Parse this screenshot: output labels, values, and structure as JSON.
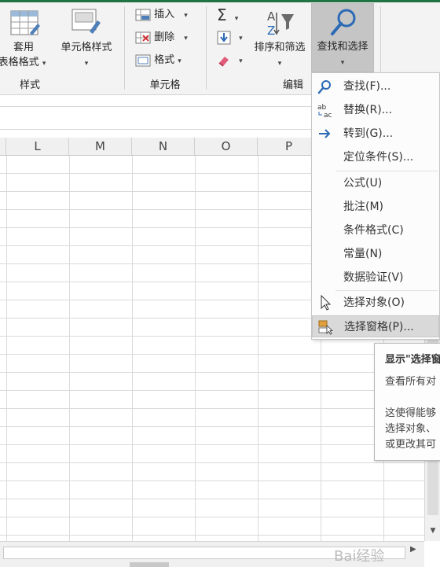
{
  "ribbon": {
    "styles_group": {
      "format_table_label_line1": "套用",
      "format_table_label_line2": "表格格式",
      "cell_styles_label": "单元格样式",
      "group_label": "样式"
    },
    "cells_group": {
      "insert_label": "插入",
      "delete_label": "删除",
      "format_label": "格式",
      "group_label": "单元格"
    },
    "editing_group": {
      "autosum_icon": "sigma-icon",
      "sort_filter_label": "排序和筛选",
      "find_select_label": "查找和选择",
      "group_label": "编辑"
    }
  },
  "columns": [
    "L",
    "M",
    "N",
    "O",
    "P"
  ],
  "menu": {
    "items": [
      {
        "label": "查找(F)...",
        "icon": "search-icon"
      },
      {
        "label": "替换(R)...",
        "icon": "replace-icon"
      },
      {
        "label": "转到(G)...",
        "icon": "arrow-right-icon"
      },
      {
        "label": "定位条件(S)...",
        "icon": ""
      },
      {
        "label": "公式(U)",
        "icon": ""
      },
      {
        "label": "批注(M)",
        "icon": ""
      },
      {
        "label": "条件格式(C)",
        "icon": ""
      },
      {
        "label": "常量(N)",
        "icon": ""
      },
      {
        "label": "数据验证(V)",
        "icon": ""
      },
      {
        "label": "选择对象(O)",
        "icon": "pointer-icon"
      },
      {
        "label": "选择窗格(P)...",
        "icon": "selection-pane-icon"
      }
    ],
    "hovered_index": 10
  },
  "tooltip": {
    "title": "显示\"选择窗",
    "line1": "查看所有对",
    "line2": "这使得能够",
    "line3": "选择对象、",
    "line4": "或更改其可"
  },
  "watermark": "Bai经验",
  "colors": {
    "accent_green": "#217346",
    "ribbon_bg": "#f3f3f3",
    "selected_button": "#c5c5c5",
    "icon_blue": "#2b6ab5"
  }
}
